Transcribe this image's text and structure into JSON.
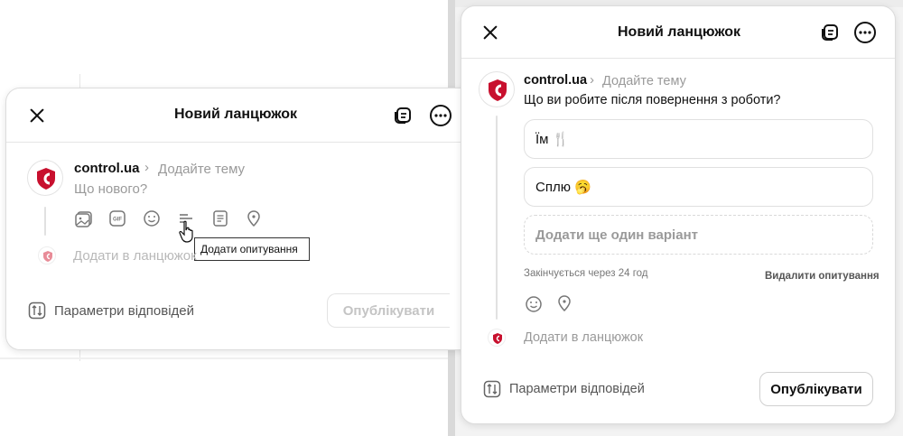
{
  "left_panel": {
    "header": {
      "title": "Новий ланцюжок"
    },
    "post": {
      "username": "control.ua",
      "topic_placeholder": "Додайте тему",
      "text_placeholder": "Що нового?",
      "tools": [
        "image-icon",
        "gif-icon",
        "emoji-icon",
        "poll-icon",
        "document-icon",
        "location-icon"
      ]
    },
    "tooltip": "Додати опитування",
    "add_to_thread": "Додати в ланцюжок",
    "reply_settings": "Параметри відповідей",
    "publish": "Опублікувати"
  },
  "right_panel": {
    "header": {
      "title": "Новий ланцюжок"
    },
    "post": {
      "username": "control.ua",
      "topic_placeholder": "Додайте тему",
      "question": "Що ви робите після повернення з роботи?"
    },
    "poll": {
      "options": [
        "Їм 🍴",
        "Сплю 🥱"
      ],
      "add_option_placeholder": "Додати ще один варіант",
      "ends_in": "Закінчується через 24 год",
      "delete": "Видалити опитування"
    },
    "add_to_thread": "Додати в ланцюжок",
    "reply_settings": "Параметри відповідей",
    "publish": "Опублікувати"
  },
  "colors": {
    "brand_red": "#c8102e",
    "muted_text": "#9a9a9a",
    "border": "#e0e0e0"
  }
}
